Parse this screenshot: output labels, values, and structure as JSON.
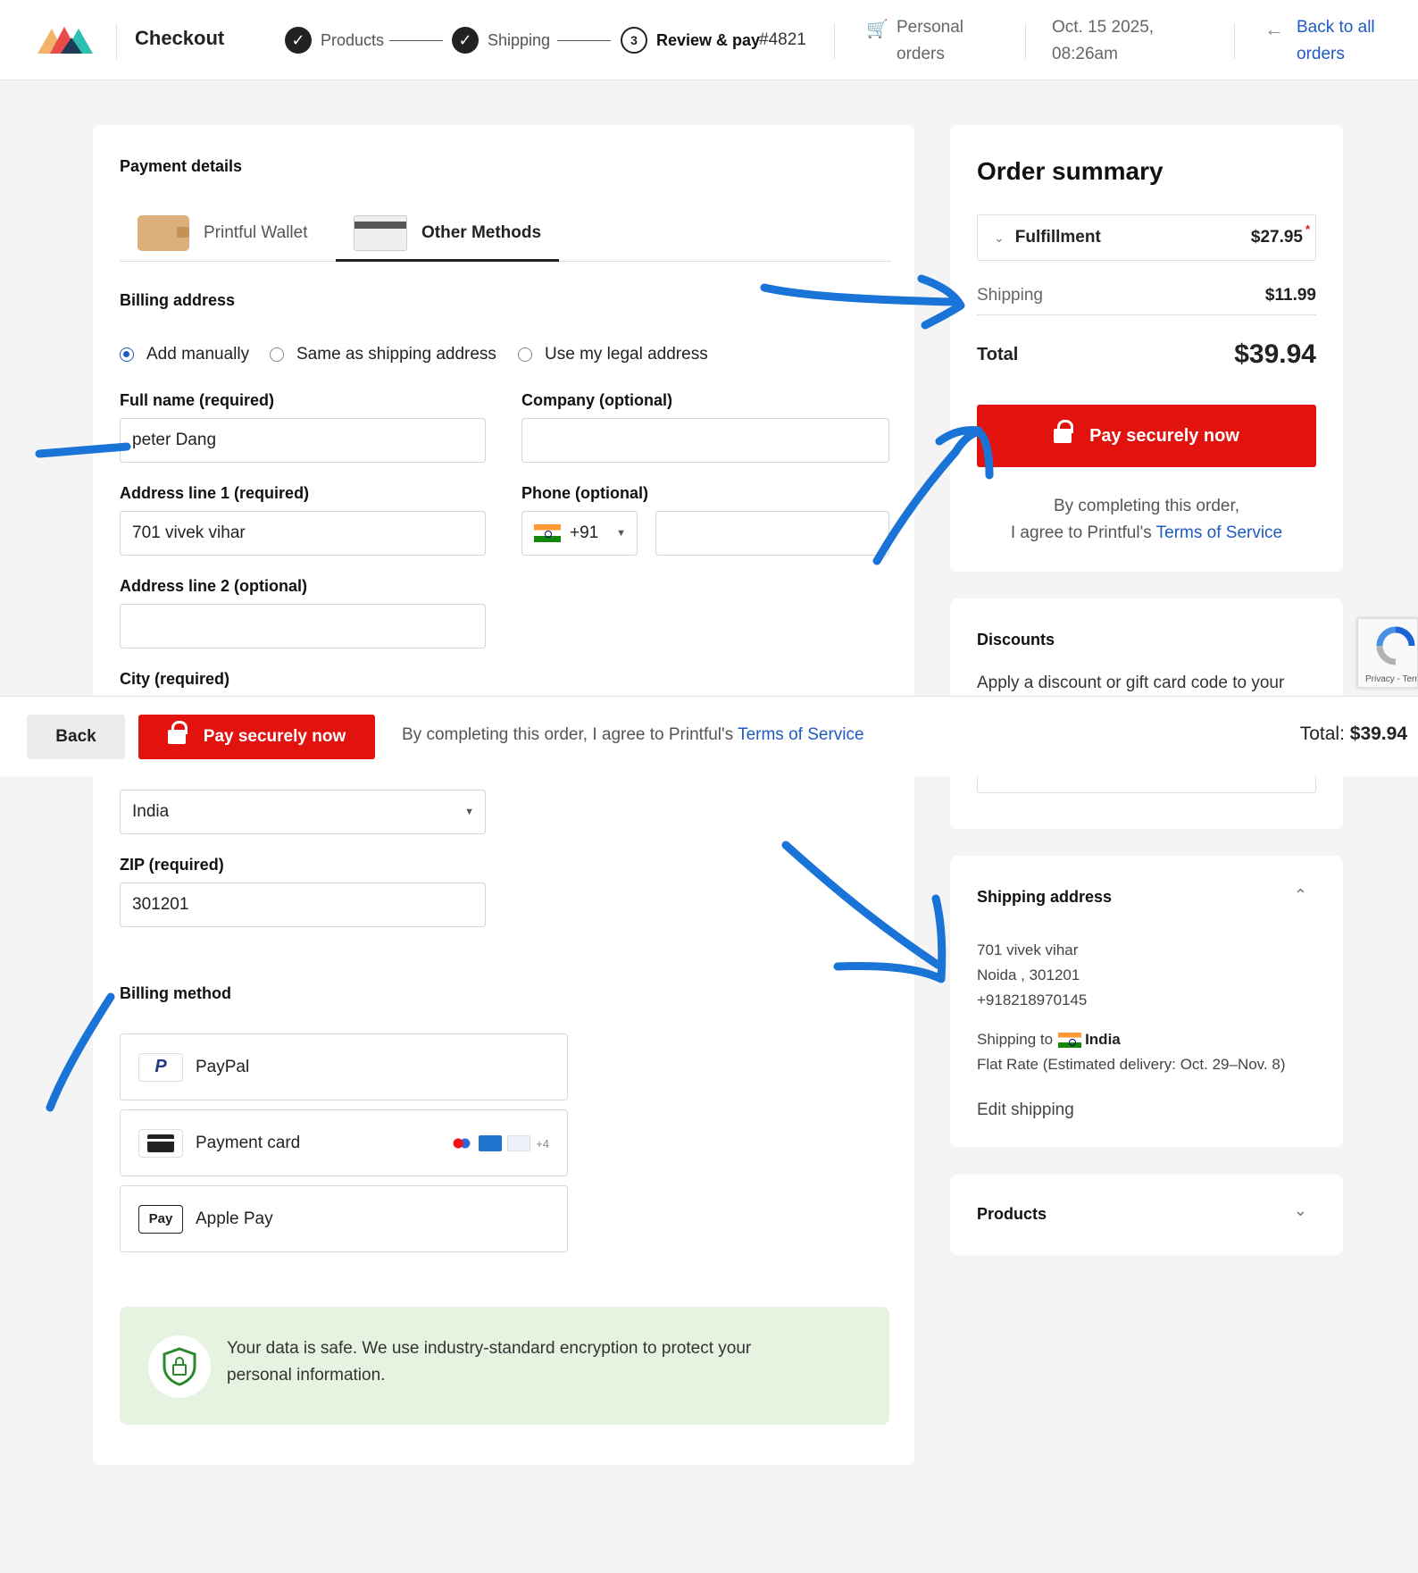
{
  "header": {
    "title": "Checkout",
    "steps": [
      {
        "label": "Products",
        "state": "done"
      },
      {
        "label": "Shipping",
        "state": "done"
      },
      {
        "label": "Review & pay",
        "number": "3",
        "state": "active"
      }
    ],
    "order_number": "#4821",
    "personal_orders": "Personal orders",
    "date_line1": "Oct. 15 2025,",
    "date_line2": "08:26am",
    "back_link": "Back to all orders"
  },
  "payment": {
    "title": "Payment details",
    "tabs": [
      "Printful Wallet",
      "Other Methods"
    ],
    "billing_title": "Billing address",
    "radios": [
      "Add manually",
      "Same as shipping address",
      "Use my legal address"
    ],
    "full_name_label": "Full name (required)",
    "full_name_value": "peter Dang",
    "company_label": "Company (optional)",
    "address1_label": "Address line 1 (required)",
    "address1_value": "701 vivek vihar",
    "phone_label": "Phone (optional)",
    "phone_code": "+91",
    "address2_label": "Address line 2 (optional)",
    "city_label": "City (required)",
    "country_value": "India",
    "zip_label": "ZIP (required)",
    "zip_value": "301201",
    "billing_method_title": "Billing method",
    "methods": [
      "PayPal",
      "Payment card",
      "Apple Pay"
    ],
    "card_more": "+4",
    "applepay_badge": "Pay",
    "safe_text": "Your data is safe. We use industry-standard encryption to protect your personal information."
  },
  "summary": {
    "title": "Order summary",
    "fulfillment_label": "Fulfillment",
    "fulfillment_value": "$27.95",
    "fulfillment_mark": "*",
    "shipping_label": "Shipping",
    "shipping_value": "$11.99",
    "total_label": "Total",
    "total_value": "$39.94",
    "pay_label": "Pay securely now",
    "agree_line1": "By completing this order,",
    "agree_line2": "I agree to Printful's",
    "terms": "Terms of Service"
  },
  "discounts": {
    "title": "Discounts",
    "text": "Apply a discount or gift card code to your"
  },
  "shipping_address": {
    "title": "Shipping address",
    "line1": "701 vivek vihar",
    "line2": "Noida , 301201",
    "line3": "+918218970145",
    "shipping_to": "Shipping to",
    "country": "India",
    "rate": "Flat Rate (Estimated delivery: Oct. 29–Nov. 8)",
    "edit": "Edit shipping"
  },
  "products": {
    "title": "Products"
  },
  "sticky": {
    "back": "Back",
    "pay": "Pay securely now",
    "agree": "By completing this order, I agree to Printful's",
    "terms": "Terms of Service",
    "total_label": "Total:",
    "total_value": "$39.94"
  },
  "recaptcha": {
    "text": "Privacy - Terms"
  },
  "colors": {
    "accent": "#1f5bbf",
    "pay_red": "#e2130f",
    "annotation": "#1a73d6",
    "safe_bg": "#e5f3e0"
  }
}
